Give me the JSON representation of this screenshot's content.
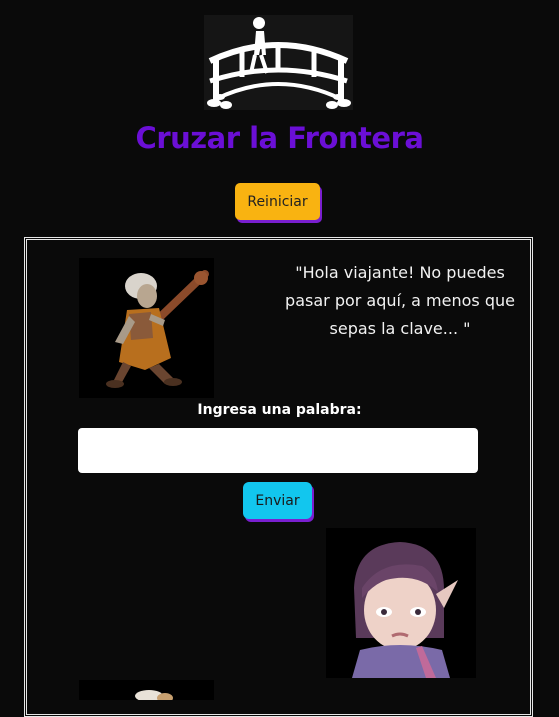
{
  "header": {
    "logo_icon": "bridge-crossing-icon",
    "title": "Cruzar la Frontera"
  },
  "controls": {
    "reset_label": "Reiniciar",
    "reset_color": "#f9b311",
    "send_label": "Enviar",
    "send_color": "#12c6ee",
    "accent_shadow": "#7a1fd0"
  },
  "dialogue": {
    "speaker_image": "old-witch-with-club",
    "quote": "\"Hola viajante! No puedes pasar por aquí, a menos que sepas la clave... \""
  },
  "form": {
    "label": "Ingresa una palabra:",
    "value": "",
    "placeholder": ""
  },
  "characters": {
    "elf_image": "elf-girl-portrait",
    "third_image": "character-portrait-partial"
  },
  "theme": {
    "background": "#0a0a0a",
    "title_color": "#6b0fd6"
  }
}
